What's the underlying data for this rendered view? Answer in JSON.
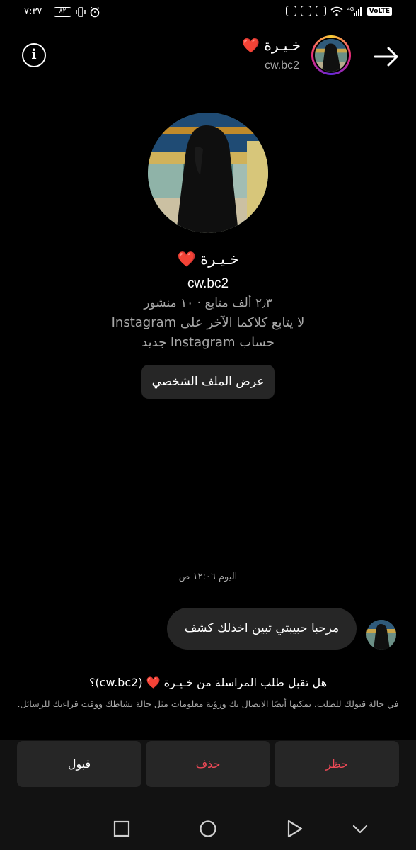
{
  "status_bar": {
    "time": "٧:٣٧",
    "battery": "٨٢",
    "network": "4G",
    "volte": "VoLTE"
  },
  "header": {
    "display_name": "خـيـرة ❤️",
    "username": "cw.bc2"
  },
  "profile": {
    "display_name": "خـيـرة ❤️",
    "username": "cw.bc2",
    "stats": "٢٫٣ ألف متابع · ١٠ منشور",
    "follow_info": "لا يتابع كلاكما الآخر على Instagram",
    "new_account": "حساب Instagram جديد",
    "view_profile_label": "عرض الملف الشخصي"
  },
  "conversation": {
    "timestamp": "اليوم ١٢:٠٦ ص",
    "messages": [
      {
        "text": "مرحبا حبيبتي تبين اخذلك كشف"
      }
    ]
  },
  "request": {
    "title": "هل تقبل طلب المراسلة من خـيـرة ❤️ (cw.bc2)؟",
    "description": "في حالة قبولك للطلب، يمكنها أيضًا الاتصال بك ورؤية معلومات مثل حالة نشاطك ووقت قراءتك للرسائل."
  },
  "actions": {
    "block": "حظر",
    "delete": "حذف",
    "accept": "قبول"
  },
  "colors": {
    "background": "#000000",
    "bubble": "#262626",
    "danger": "#ed4956",
    "secondary_text": "#a8a8a8"
  },
  "icons": [
    "info-icon",
    "back-arrow-icon",
    "nav-recents-icon",
    "nav-home-icon",
    "nav-back-icon",
    "nav-collapse-icon"
  ]
}
